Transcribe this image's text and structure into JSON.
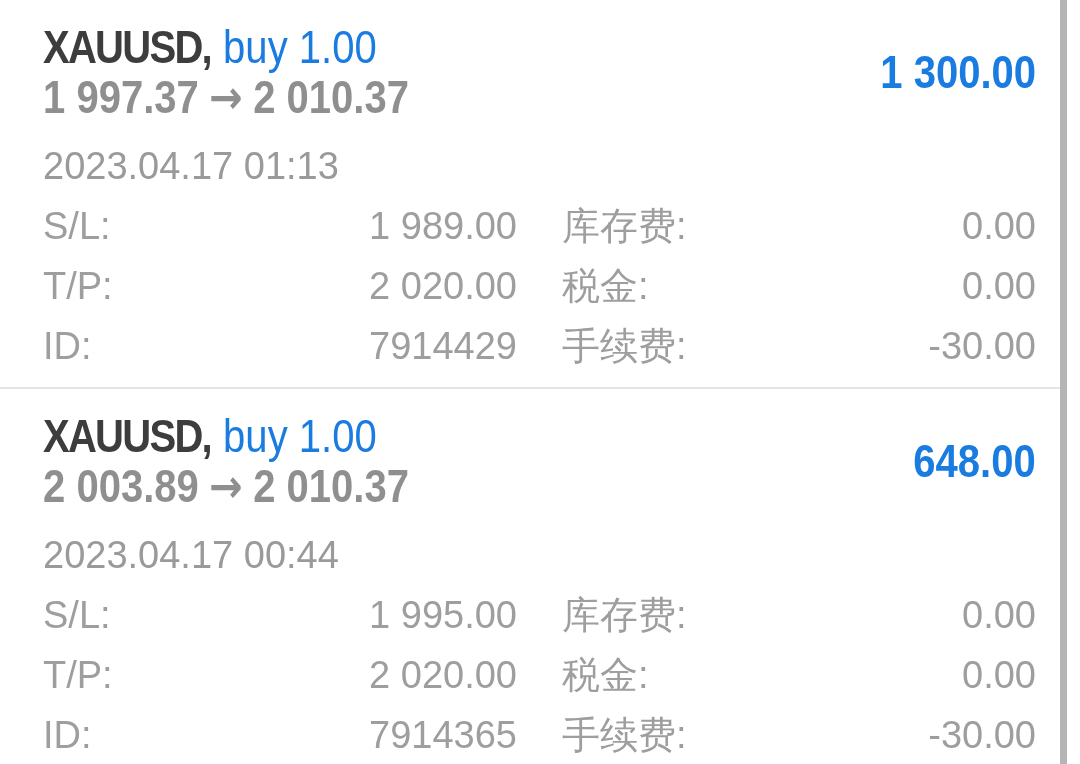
{
  "trades": [
    {
      "symbol": "XAUUSD,",
      "order": "buy 1.00",
      "open_price": "1 997.37",
      "arrow": "→",
      "current_price": "2 010.37",
      "profit": "1 300.00",
      "time": "2023.04.17 01:13",
      "details": [
        {
          "label": "S/L:",
          "value": "1 989.00"
        },
        {
          "label": "库存费:",
          "value": "0.00"
        },
        {
          "label": "T/P:",
          "value": "2 020.00"
        },
        {
          "label": "税金:",
          "value": "0.00"
        },
        {
          "label": "ID:",
          "value": "7914429"
        },
        {
          "label": "手续费:",
          "value": "-30.00"
        }
      ]
    },
    {
      "symbol": "XAUUSD,",
      "order": "buy 1.00",
      "open_price": "2 003.89",
      "arrow": "→",
      "current_price": "2 010.37",
      "profit": "648.00",
      "time": "2023.04.17 00:44",
      "details": [
        {
          "label": "S/L:",
          "value": "1 995.00"
        },
        {
          "label": "库存费:",
          "value": "0.00"
        },
        {
          "label": "T/P:",
          "value": "2 020.00"
        },
        {
          "label": "税金:",
          "value": "0.00"
        },
        {
          "label": "ID:",
          "value": "7914365"
        },
        {
          "label": "手续费:",
          "value": "-30.00"
        }
      ]
    }
  ]
}
